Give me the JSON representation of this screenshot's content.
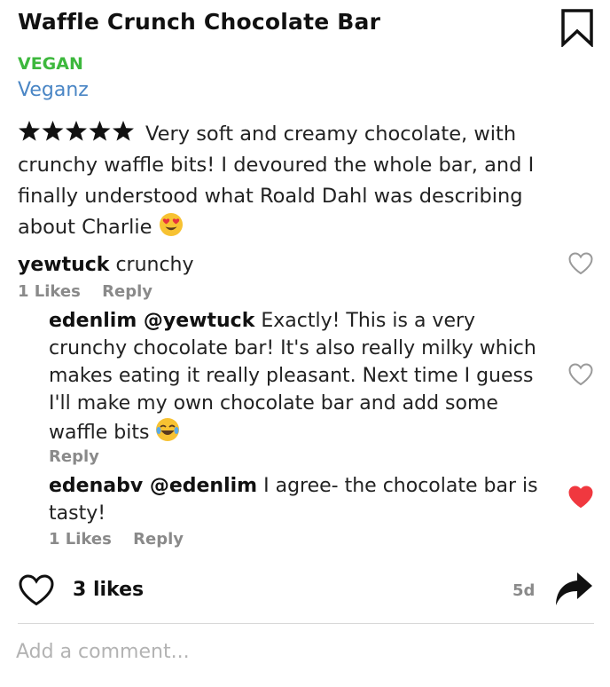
{
  "product": {
    "title": "Waffle Crunch Chocolate Bar",
    "tag": "VEGAN",
    "brand": "Veganz"
  },
  "review": {
    "rating": 5,
    "max_rating": 5,
    "text": "Very soft and creamy chocolate, with crunchy waffle bits! I devoured the whole bar, and I finally understood what Roald Dahl was describing about Charlie",
    "emoji": "heart-eyes-emoji"
  },
  "comments": [
    {
      "user": "yewtuck",
      "text": "crunchy",
      "likes_label": "1 Likes",
      "reply_label": "Reply",
      "liked": false
    },
    {
      "user": "edenlim @yewtuck",
      "text": "Exactly! This is a very crunchy chocolate bar! It's also really milky which makes eating it really pleasant. Next time I guess I'll make my own chocolate bar and add some waffle bits",
      "emoji": "tears-of-joy-emoji",
      "reply_label": "Reply",
      "liked": false
    },
    {
      "user": "edenabv @edenlim",
      "text": "I agree- the chocolate bar is tasty!",
      "likes_label": "1 Likes",
      "reply_label": "Reply",
      "liked": true
    }
  ],
  "footer": {
    "likes_label": "3 likes",
    "age": "5d",
    "add_comment_placeholder": "Add a comment..."
  },
  "colors": {
    "tag": "#3db83d",
    "brand": "#4a86c5",
    "liked_heart": "#f0383f",
    "muted": "#8a8a8a"
  }
}
